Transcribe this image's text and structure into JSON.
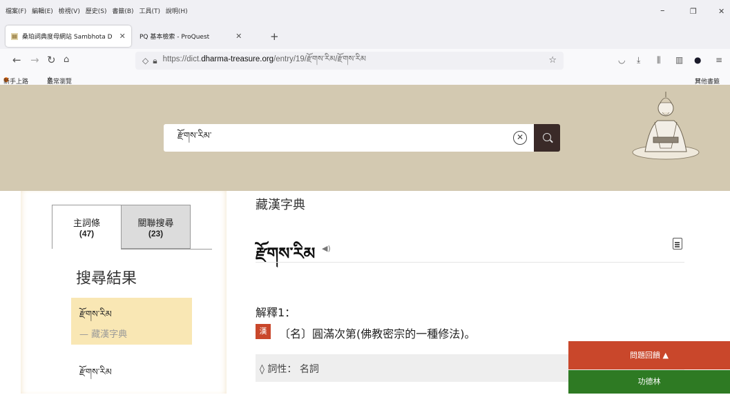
{
  "window": {
    "menu": [
      "檔案(F)",
      "編輯(E)",
      "檢視(V)",
      "歷史(S)",
      "書籤(B)",
      "工具(T)",
      "說明(H)"
    ],
    "controls": {
      "minimize": "–",
      "restore": "❐",
      "close": "✕"
    }
  },
  "tabs": [
    {
      "label": "桑珀詞典度母網站 Sambhota D",
      "close": "✕",
      "active": true
    },
    {
      "label": "PQ 基本檢索 - ProQuest",
      "close": "✕",
      "active": false
    }
  ],
  "new_tab": "+",
  "nav": {
    "url_prefix": "https://dict.",
    "url_domain": "dharma-treasure.org",
    "url_path": "/entry/19/རྫོགས་རིམ/རྫོགས་རིམ"
  },
  "bookmarks": {
    "items": [
      "新手上路",
      "最常瀏覽"
    ],
    "other": "其他書籤"
  },
  "search": {
    "query": "རྫོགས་རིམ་"
  },
  "sidebar": {
    "tab_main": {
      "label": "主詞條",
      "count": "(47)"
    },
    "tab_related": {
      "label": "關聯搜尋",
      "count": "(23)"
    },
    "results_title": "搜尋結果",
    "results": [
      {
        "term": "རྫོགས་རིམ",
        "source": "— 藏漢字典"
      },
      {
        "term": "རྫོགས་རིམ",
        "source": ""
      }
    ]
  },
  "entry": {
    "dictionary": "藏漢字典",
    "headword": "རྫོགས་རིམ",
    "definition_label": "解釋1：",
    "lang_badge": "漢",
    "definition": "〔名〕圓滿次第(佛教密宗的一種修法)。",
    "pos": "◊ 詞性： 名詞"
  },
  "floating": {
    "top_button": "問題回饋 ▲",
    "bottom_button": "功德林"
  },
  "colors": {
    "hero": "#d3c9b1",
    "search_button": "#3a2a28",
    "selected_result": "#f9e7b4",
    "badge": "#c9472b",
    "green_button": "#2e7a23"
  }
}
